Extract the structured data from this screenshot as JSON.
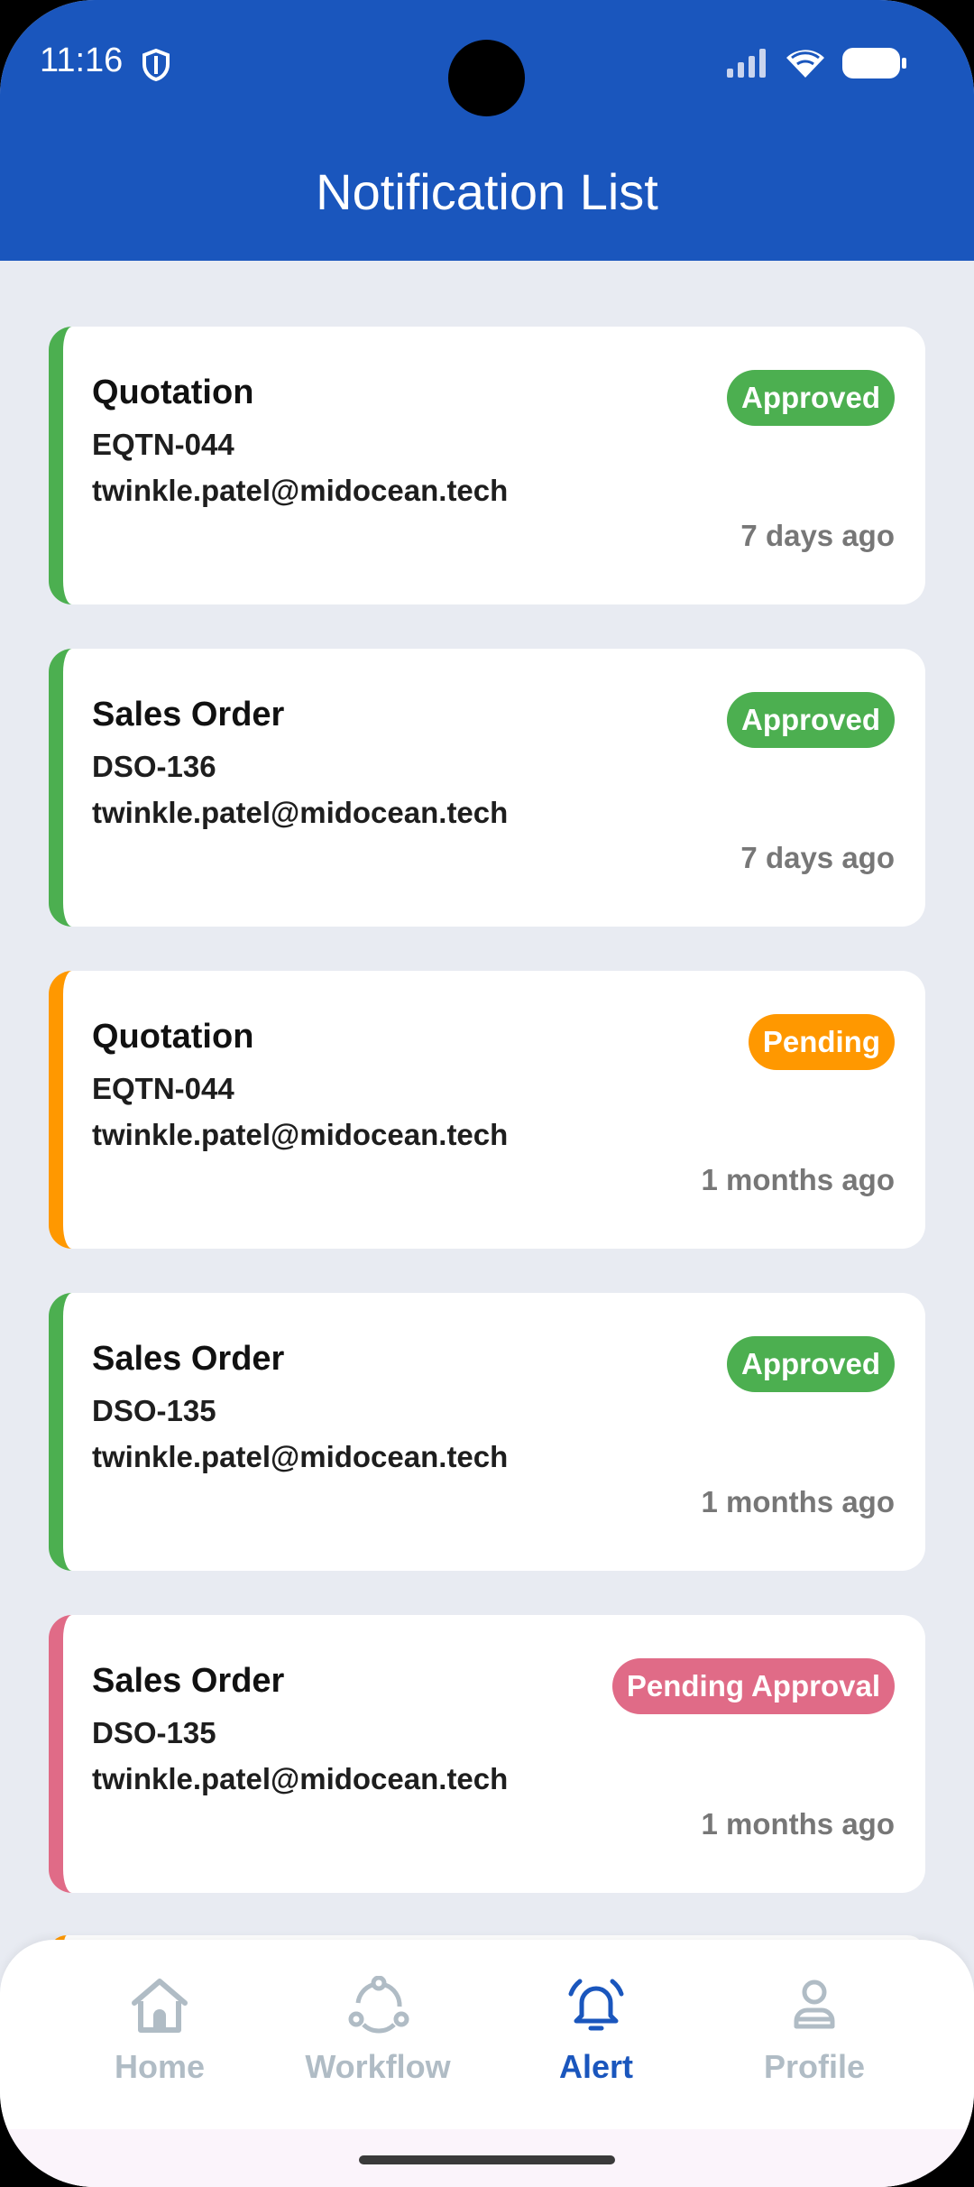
{
  "status_bar": {
    "time": "11:16"
  },
  "header": {
    "title": "Notification List"
  },
  "notifications": [
    {
      "type": "Quotation",
      "code": "EQTN-044",
      "email": "twinkle.patel@midocean.tech",
      "status": "Approved",
      "time": "7 days ago",
      "color": "#4caf50"
    },
    {
      "type": "Sales Order",
      "code": "DSO-136",
      "email": "twinkle.patel@midocean.tech",
      "status": "Approved",
      "time": "7 days ago",
      "color": "#4caf50"
    },
    {
      "type": "Quotation",
      "code": "EQTN-044",
      "email": "twinkle.patel@midocean.tech",
      "status": "Pending",
      "time": "1 months ago",
      "color": "#ff9800"
    },
    {
      "type": "Sales Order",
      "code": "DSO-135",
      "email": "twinkle.patel@midocean.tech",
      "status": "Approved",
      "time": "1 months ago",
      "color": "#4caf50"
    },
    {
      "type": "Sales Order",
      "code": "DSO-135",
      "email": "twinkle.patel@midocean.tech",
      "status": "Pending Approval",
      "time": "1 months ago",
      "color": "#e06b87"
    }
  ],
  "nav": {
    "items": [
      {
        "label": "Home",
        "icon": "home-icon",
        "active": false
      },
      {
        "label": "Workflow",
        "icon": "workflow-icon",
        "active": false
      },
      {
        "label": "Alert",
        "icon": "bell-icon",
        "active": true
      },
      {
        "label": "Profile",
        "icon": "profile-icon",
        "active": false
      }
    ],
    "active_color": "#1a56bd",
    "inactive_color": "#b0bcc5"
  }
}
